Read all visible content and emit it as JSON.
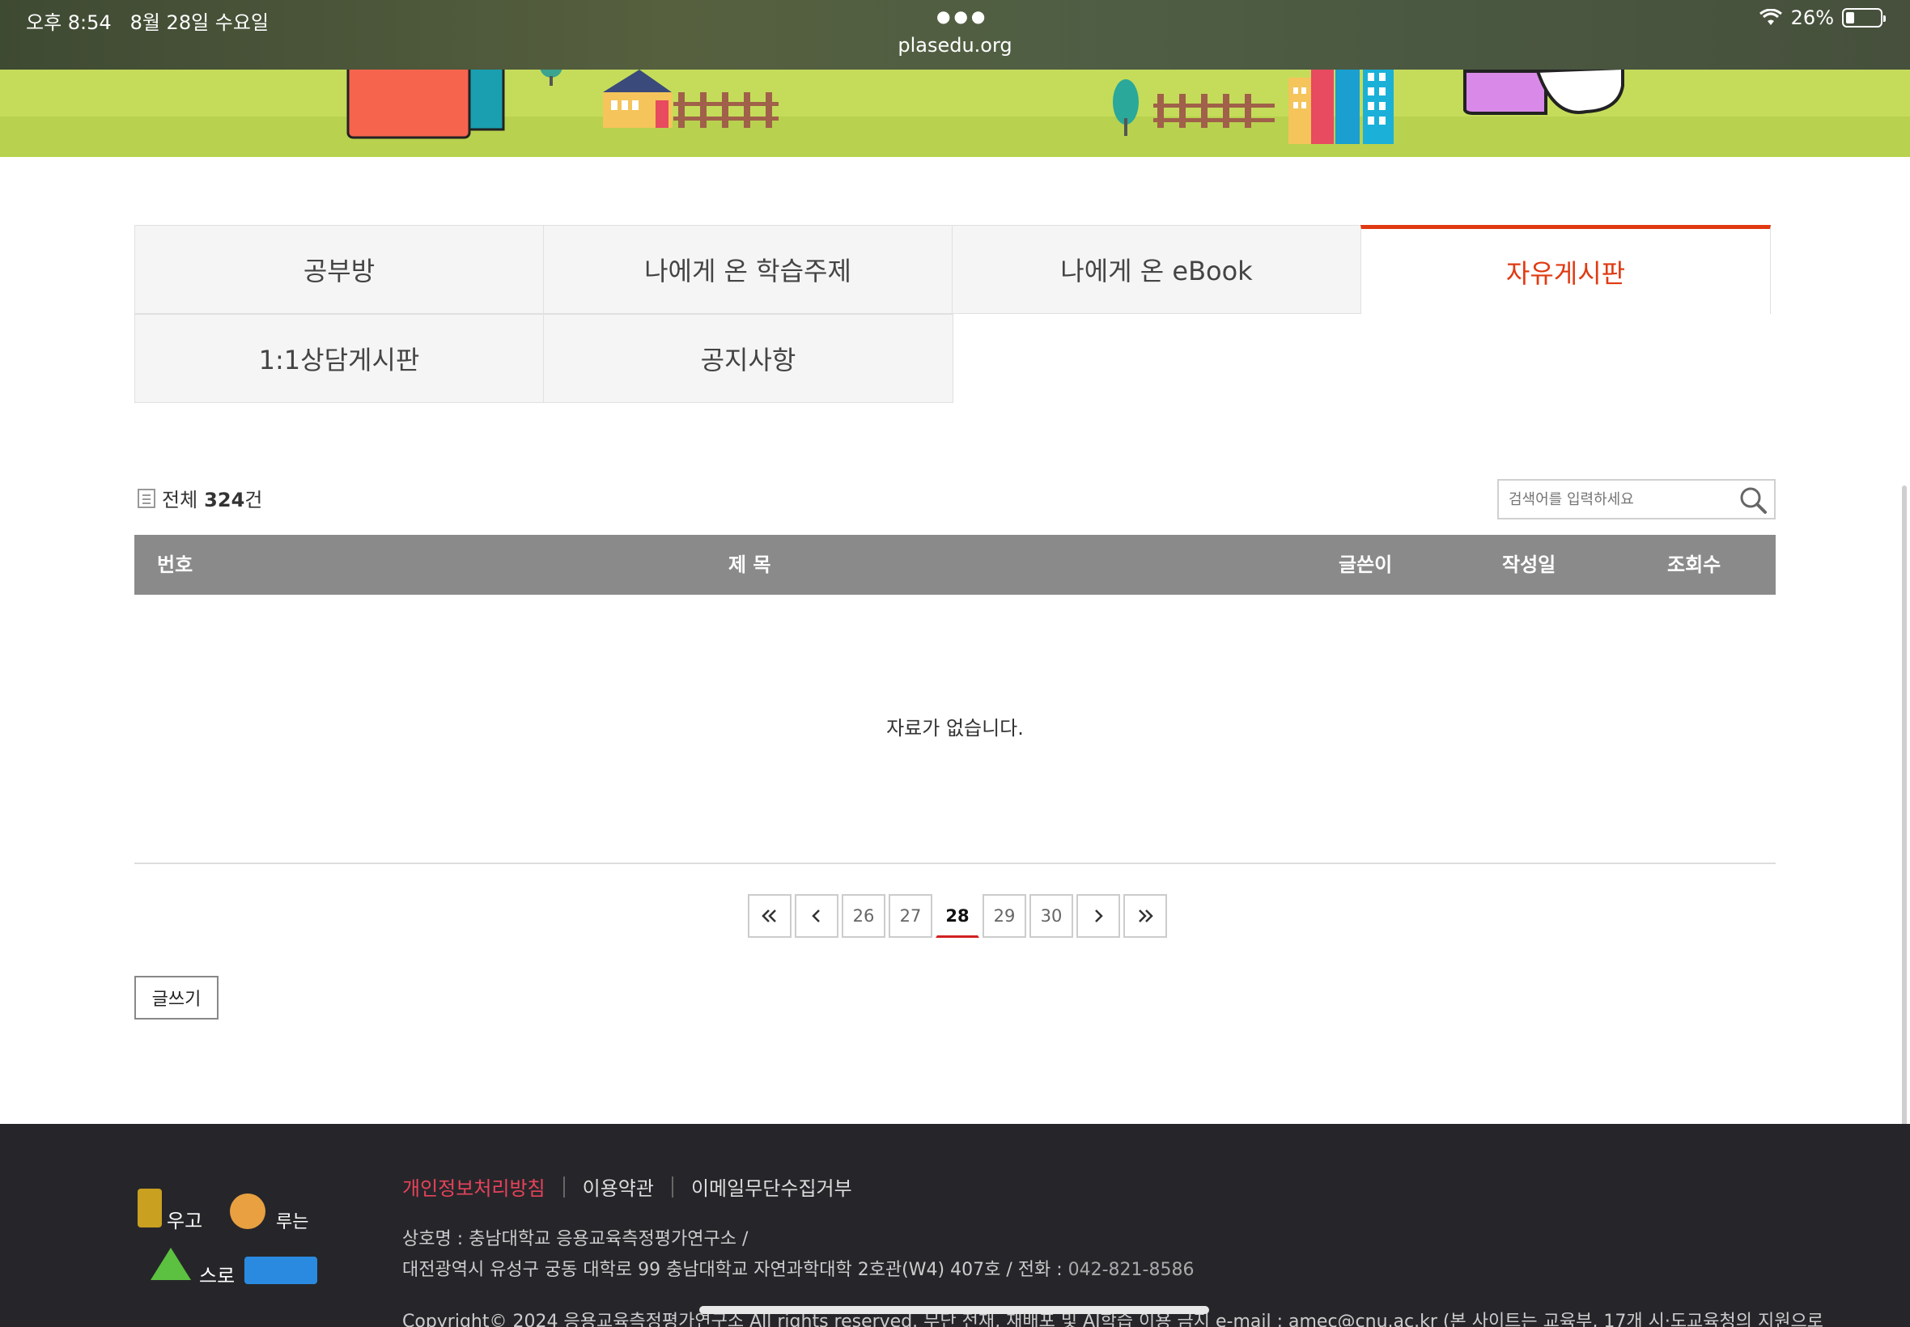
{
  "status_bar": {
    "time": "오후 8:54",
    "date": "8월 28일 수요일",
    "url": "plasedu.org",
    "battery": "26%",
    "icons": [
      "wifi-icon",
      "battery-icon",
      "more-dots-icon"
    ]
  },
  "tabs": [
    {
      "label": "공부방",
      "active": false
    },
    {
      "label": "나에게 온 학습주제",
      "active": false
    },
    {
      "label": "나에게 온 eBook",
      "active": false
    },
    {
      "label": "자유게시판",
      "active": true
    },
    {
      "label": "1:1상담게시판",
      "active": false
    },
    {
      "label": "공지사항",
      "active": false
    }
  ],
  "board": {
    "total_prefix": "전체",
    "total_count": "324",
    "total_suffix": "건",
    "search_placeholder": "검색어를 입력하세요",
    "columns": [
      "번호",
      "제 목",
      "글쓴이",
      "작성일",
      "조회수"
    ],
    "empty_message": "자료가 없습니다.",
    "write_label": "글쓰기"
  },
  "pagination": {
    "pages": [
      "26",
      "27",
      "28",
      "29",
      "30"
    ],
    "current": "28"
  },
  "footer": {
    "links": [
      "개인정보처리방침",
      "이용약관",
      "이메일무단수집거부"
    ],
    "company": "상호명 : 충남대학교 응용교육측정평가연구소 /",
    "address": "대전광역시 유성구 궁동 대학로 99 충남대학교 자연과학대학 2호관(W4) 407호 / 전화 : ",
    "phone": "042-821-8586",
    "copyright": "Copyright© 2024 응용교육측정평가연구소 All rights reserved. 무단 전재, 재배포 및 AI학습 이용 금지 e-mail : amec@cnu.ac.kr (본 사이트는 교육부, 17개 시·도교육청의 지원으로"
  },
  "colors": {
    "accent": "#e03a12",
    "table_header": "#8a8a8a",
    "footer_bg": "#26262a",
    "privacy_link": "#e8425a"
  }
}
